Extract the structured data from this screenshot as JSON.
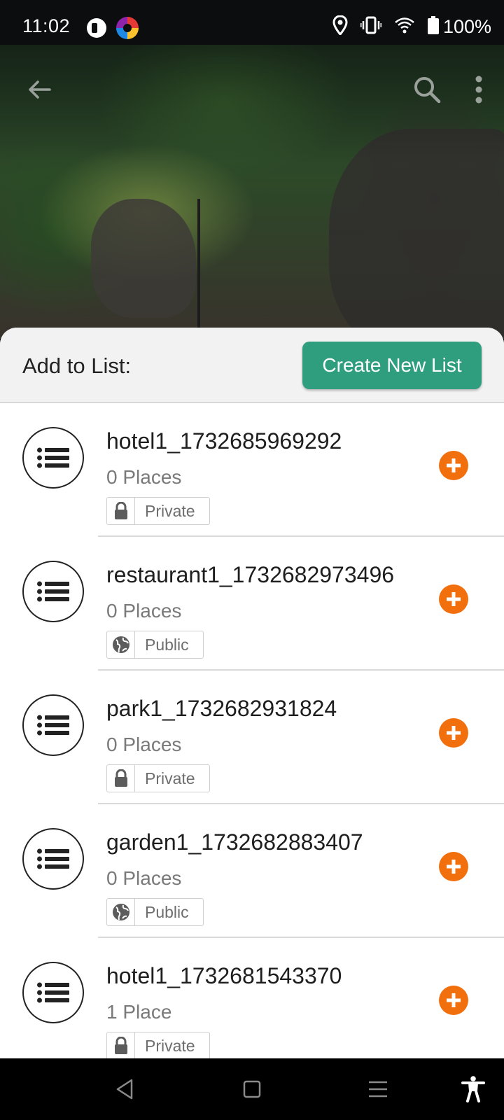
{
  "status_bar": {
    "time": "11:02",
    "battery": "100%",
    "icons": [
      "app-icon",
      "photos-app-icon",
      "location-icon",
      "vibrate-icon",
      "wifi-icon",
      "battery-icon"
    ]
  },
  "toolbar": {
    "icons": [
      "back-arrow-icon",
      "search-icon",
      "more-vert-icon"
    ]
  },
  "sheet": {
    "title": "Add to List:",
    "create_button": "Create New List"
  },
  "lists": [
    {
      "name": "hotel1_1732685969292",
      "count": "0 Places",
      "visibility": "Private",
      "visibility_icon": "lock-icon"
    },
    {
      "name": "restaurant1_1732682973496",
      "count": "0 Places",
      "visibility": "Public",
      "visibility_icon": "globe-icon"
    },
    {
      "name": "park1_1732682931824",
      "count": "0 Places",
      "visibility": "Private",
      "visibility_icon": "lock-icon"
    },
    {
      "name": "garden1_1732682883407",
      "count": "0 Places",
      "visibility": "Public",
      "visibility_icon": "globe-icon"
    },
    {
      "name": "hotel1_1732681543370",
      "count": "1 Place",
      "visibility": "Private",
      "visibility_icon": "lock-icon"
    }
  ],
  "colors": {
    "accent_green": "#2e9e7e",
    "add_orange": "#f26f0e"
  },
  "nav_bar": {
    "icons": [
      "back-triangle-icon",
      "home-square-icon",
      "recents-icon",
      "accessibility-icon"
    ]
  }
}
